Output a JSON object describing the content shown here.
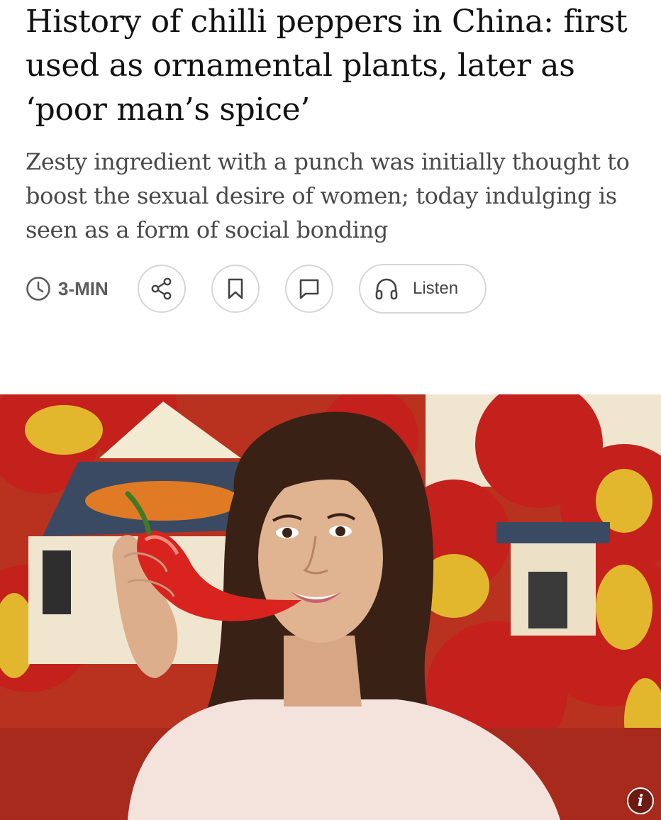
{
  "article": {
    "headline": "History of chilli peppers in China: first used as ornamental plants, later as ‘poor man’s spice’",
    "standfirst": "Zesty ingredient with a punch was initially thought to boost the sexual desire of women; today indulging is seen as a form of social bonding"
  },
  "meta": {
    "read_time": "3-MIN",
    "listen_label": "Listen",
    "icons": [
      "clock-icon",
      "share-icon",
      "bookmark-icon",
      "comment-icon",
      "headphones-icon"
    ]
  },
  "hero": {
    "info_label": "i"
  },
  "colors": {
    "text": "#111111",
    "subtext": "#4a4a4a",
    "meta": "#5c5c5c",
    "button_border": "#d6d6d6",
    "chilli_red": "#d8231f"
  }
}
